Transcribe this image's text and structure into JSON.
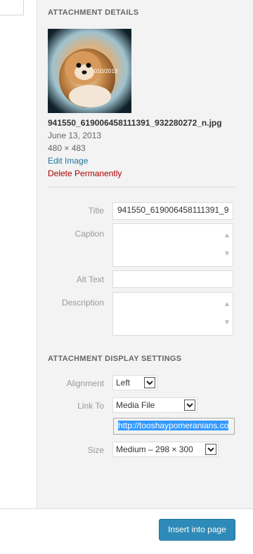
{
  "details": {
    "title": "ATTACHMENT DETAILS",
    "thumbnail_icon": "pomeranian-dog-photo",
    "thumbnail_watermark": "010/2013",
    "filename": "941550_619006458111391_932280272_n.jpg",
    "date": "June 13, 2013",
    "dimensions": "480 × 483",
    "edit_link": "Edit Image",
    "delete_link": "Delete Permanently"
  },
  "fields": {
    "title_label": "Title",
    "title_value": "941550_619006458111391_9",
    "caption_label": "Caption",
    "caption_value": "",
    "alt_label": "Alt Text",
    "alt_value": "",
    "description_label": "Description",
    "description_value": ""
  },
  "display": {
    "title": "ATTACHMENT DISPLAY SETTINGS",
    "alignment_label": "Alignment",
    "alignment_value": "Left",
    "link_label": "Link To",
    "link_value": "Media File",
    "url_value": "http://tooshaypomeranians.co",
    "size_label": "Size",
    "size_value": "Medium – 298 × 300"
  },
  "footer": {
    "insert_button": "Insert into page"
  },
  "colors": {
    "link": "#21759b",
    "delete": "#aa0000",
    "primary_button": "#2e8ab8",
    "selection": "#3399ff"
  }
}
